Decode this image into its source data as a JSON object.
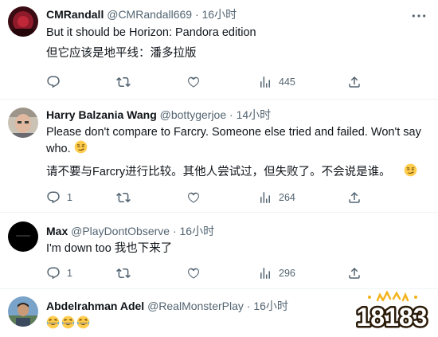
{
  "tweets": [
    {
      "name": "CMRandall",
      "handle": "@CMRandall669",
      "separator": "·",
      "time": "16小时",
      "lines": [
        "But it should be Horizon: Pandora edition",
        "但它应该是地平线：潘多拉版"
      ],
      "reply_count": "",
      "retweet_count": "",
      "like_count": "",
      "view_count": "445"
    },
    {
      "name": "Harry Balzania Wang",
      "handle": "@bottygerjoe",
      "separator": "·",
      "time": "14小时",
      "lines": [
        "Please don't compare to Farcry. Someone else tried and failed. Won't say who.",
        "请不要与Farcry进行比较。其他人尝试过，但失败了。不会说是谁。"
      ],
      "reply_count": "1",
      "retweet_count": "",
      "like_count": "",
      "view_count": "264"
    },
    {
      "name": "Max",
      "handle": "@PlayDontObserve",
      "separator": "·",
      "time": "16小时",
      "lines": [
        "I'm down too 我也下来了"
      ],
      "reply_count": "1",
      "retweet_count": "",
      "like_count": "",
      "view_count": "296"
    },
    {
      "name": "Abdelrahman Adel",
      "handle": "@RealMonsterPlay",
      "separator": "·",
      "time": "16小时",
      "lines": [
        ""
      ]
    }
  ],
  "icons": {
    "more": "more-icon",
    "reply": "reply-icon",
    "retweet": "retweet-icon",
    "like": "like-icon",
    "views": "views-icon",
    "share": "share-icon",
    "emoji_smirk": "smirk-emoji",
    "emoji_laugh": "laugh-cry-emoji"
  },
  "colors": {
    "text": "#0f1419",
    "secondary": "#536471",
    "divider": "#eff3f4",
    "watermark_gold": "#f3b31d"
  },
  "watermark": {
    "text": "18183"
  }
}
